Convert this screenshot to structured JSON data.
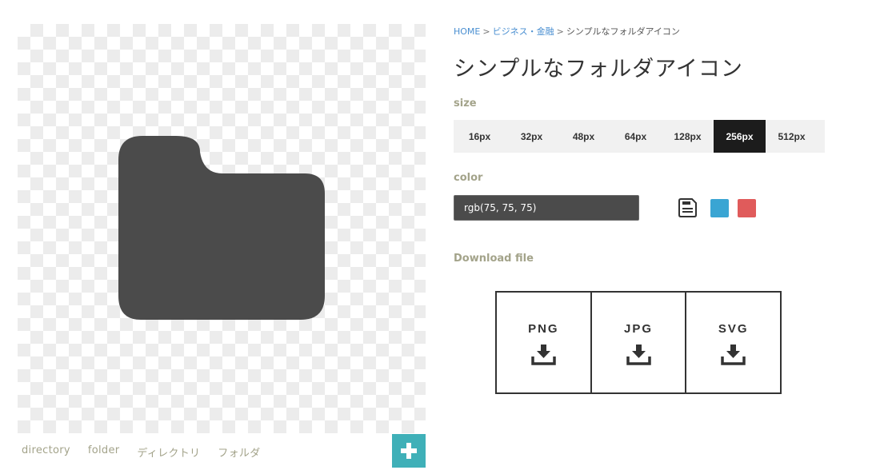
{
  "breadcrumb": {
    "home": "HOME",
    "separator": ">",
    "category": "ビジネス・金融",
    "current": "シンプルなフォルダアイコン"
  },
  "title": "シンプルなフォルダアイコン",
  "size_section": {
    "label": "size",
    "options": [
      "16px",
      "32px",
      "48px",
      "64px",
      "128px",
      "256px",
      "512px"
    ],
    "selected": "256px"
  },
  "color_section": {
    "label": "color",
    "value": "rgb(75, 75, 75)",
    "swatches": [
      {
        "name": "blue",
        "color": "#3aa5d3"
      },
      {
        "name": "red",
        "color": "#e05b5b"
      }
    ]
  },
  "download_section": {
    "label": "Download file",
    "formats": [
      "PNG",
      "JPG",
      "SVG"
    ]
  },
  "preview": {
    "icon": "folder-icon",
    "icon_color": "#4b4b4b"
  },
  "tags": [
    "directory",
    "folder",
    "ディレクトリ",
    "フォルダ"
  ],
  "add_button": {
    "icon": "plus-icon",
    "color": "#3fb0b8"
  }
}
